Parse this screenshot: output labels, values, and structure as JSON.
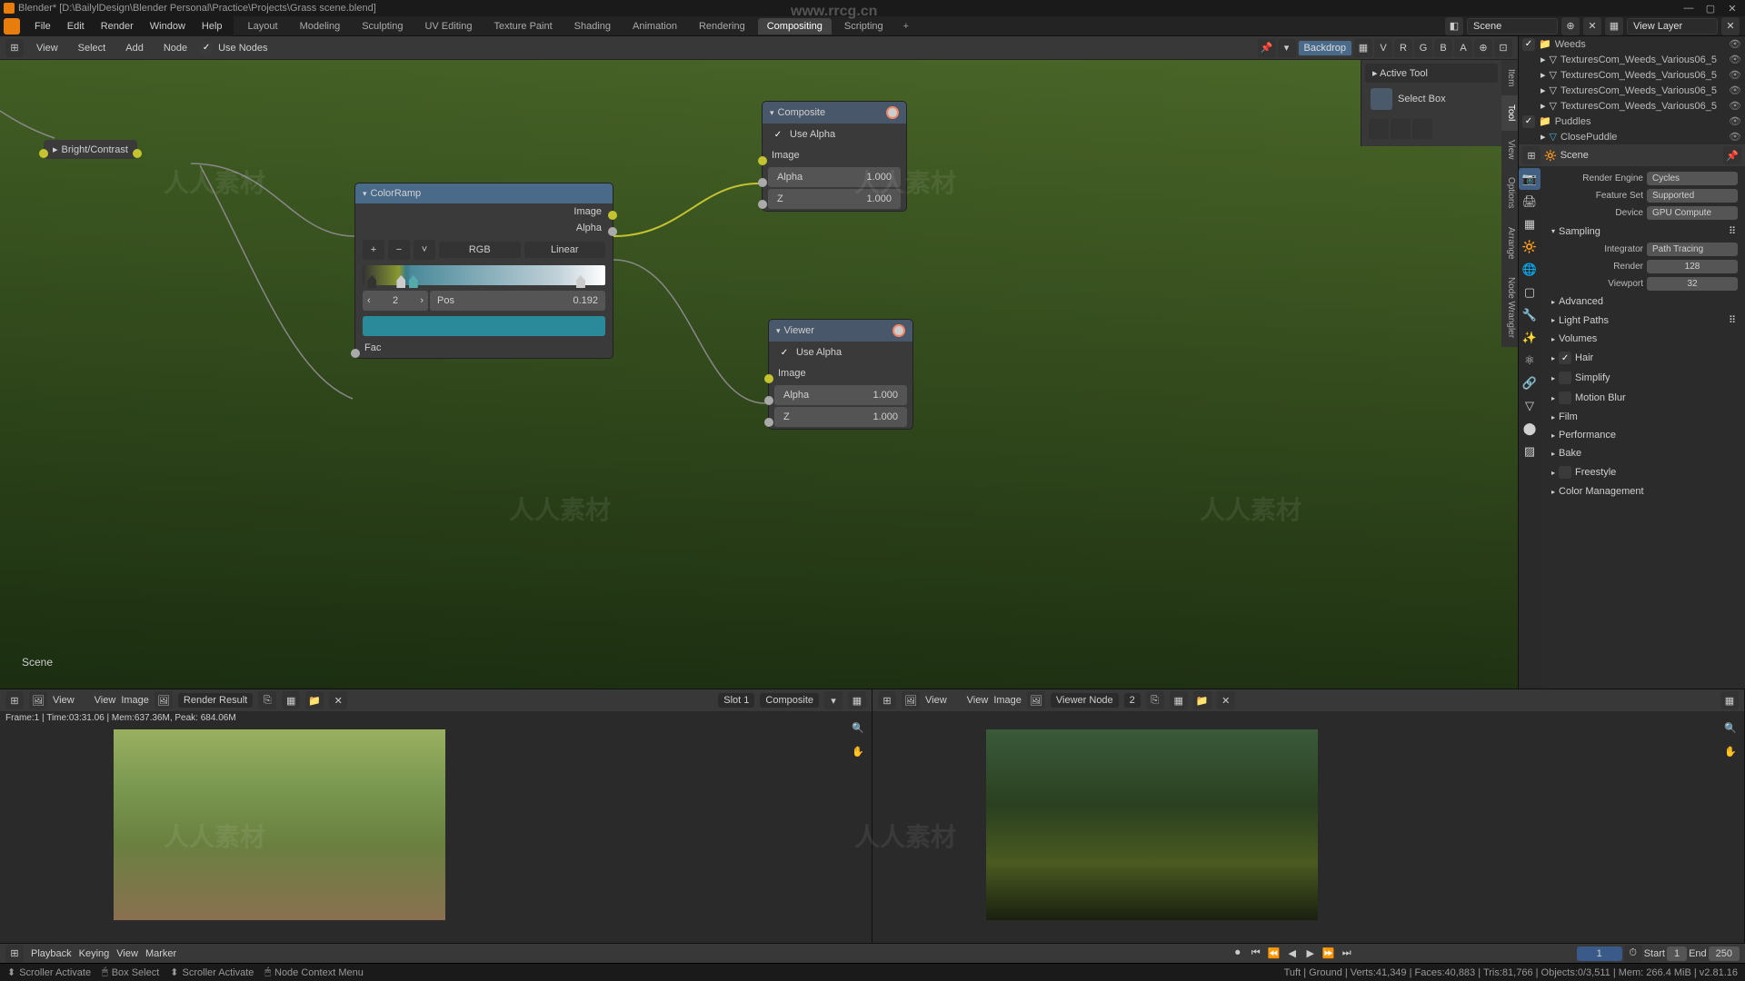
{
  "window": {
    "title": "Blender* [D:\\BailylDesign\\Blender Personal\\Practice\\Projects\\Grass scene.blend]",
    "watermark_url": "www.rrcg.cn",
    "watermark_text": "人人素材"
  },
  "topmenu": {
    "items": [
      "File",
      "Edit",
      "Render",
      "Window",
      "Help"
    ]
  },
  "workspaces": {
    "tabs": [
      "Layout",
      "Modeling",
      "Sculpting",
      "UV Editing",
      "Texture Paint",
      "Shading",
      "Animation",
      "Rendering",
      "Compositing",
      "Scripting"
    ],
    "active": "Compositing",
    "scene_label": "Scene",
    "viewlayer_label": "View Layer"
  },
  "node_header": {
    "items": [
      "View",
      "Select",
      "Add",
      "Node"
    ],
    "use_nodes_label": "Use Nodes",
    "backdrop_label": "Backdrop",
    "channels": [
      "V",
      "R",
      "G",
      "B",
      "A"
    ]
  },
  "scene_text": "Scene",
  "bc_node": {
    "title": "Bright/Contrast"
  },
  "colorramp": {
    "title": "ColorRamp",
    "out_image": "Image",
    "out_alpha": "Alpha",
    "mode": "RGB",
    "interp": "Linear",
    "index": "2",
    "pos_label": "Pos",
    "pos_value": "0.192",
    "fac_label": "Fac",
    "color_hex": "#2a8a9a"
  },
  "composite": {
    "title": "Composite",
    "use_alpha": "Use Alpha",
    "image": "Image",
    "alpha_label": "Alpha",
    "alpha_val": "1.000",
    "z_label": "Z",
    "z_val": "1.000"
  },
  "viewer": {
    "title": "Viewer",
    "use_alpha": "Use Alpha",
    "image": "Image",
    "alpha_label": "Alpha",
    "alpha_val": "1.000",
    "z_label": "Z",
    "z_val": "1.000"
  },
  "vtabs": [
    "Item",
    "Tool",
    "View",
    "Options",
    "Arrange",
    "Node Wrangler"
  ],
  "tool_panel": {
    "title": "Active Tool",
    "select_box": "Select Box"
  },
  "outliner": {
    "items": [
      {
        "name": "Weeds",
        "kind": "collection"
      },
      {
        "name": "TexturesCom_Weeds_Various06_5",
        "kind": "mesh"
      },
      {
        "name": "TexturesCom_Weeds_Various06_5",
        "kind": "mesh"
      },
      {
        "name": "TexturesCom_Weeds_Various06_5",
        "kind": "mesh"
      },
      {
        "name": "TexturesCom_Weeds_Various06_5",
        "kind": "mesh"
      },
      {
        "name": "Puddles",
        "kind": "collection"
      },
      {
        "name": "ClosePuddle",
        "kind": "mesh"
      }
    ]
  },
  "props": {
    "scene_name": "Scene",
    "render_engine_label": "Render Engine",
    "render_engine": "Cycles",
    "feature_set_label": "Feature Set",
    "feature_set": "Supported",
    "device_label": "Device",
    "device": "GPU Compute",
    "sampling_label": "Sampling",
    "integrator_label": "Integrator",
    "integrator": "Path Tracing",
    "render_label": "Render",
    "render_samples": "128",
    "viewport_label": "Viewport",
    "viewport_samples": "32",
    "sections": [
      "Advanced",
      "Light Paths",
      "Volumes",
      "Hair",
      "Simplify",
      "Motion Blur",
      "Film",
      "Performance",
      "Bake",
      "Freestyle",
      "Color Management"
    ],
    "hair_checked": true
  },
  "image_left": {
    "view": "View",
    "image": "Image",
    "result": "Render Result",
    "slot": "Slot 1",
    "layer": "Composite",
    "frame_info": "Frame:1 | Time:03:31.06 | Mem:637.36M, Peak: 684.06M"
  },
  "image_right": {
    "view": "View",
    "image": "Image",
    "result": "Viewer Node",
    "slot_num": "2"
  },
  "timeline": {
    "playback": "Playback",
    "keying": "Keying",
    "view": "View",
    "marker": "Marker",
    "current": "1",
    "start_label": "Start",
    "start": "1",
    "end_label": "End",
    "end": "250"
  },
  "status": {
    "scroller": "Scroller Activate",
    "box_select": "Box Select",
    "scroller2": "Scroller Activate",
    "context": "Node Context Menu",
    "stats": "Tuft | Ground | Verts:41,349 | Faces:40,883 | Tris:81,766 | Objects:0/3,511 | Mem: 266.4 MiB | v2.81.16"
  }
}
